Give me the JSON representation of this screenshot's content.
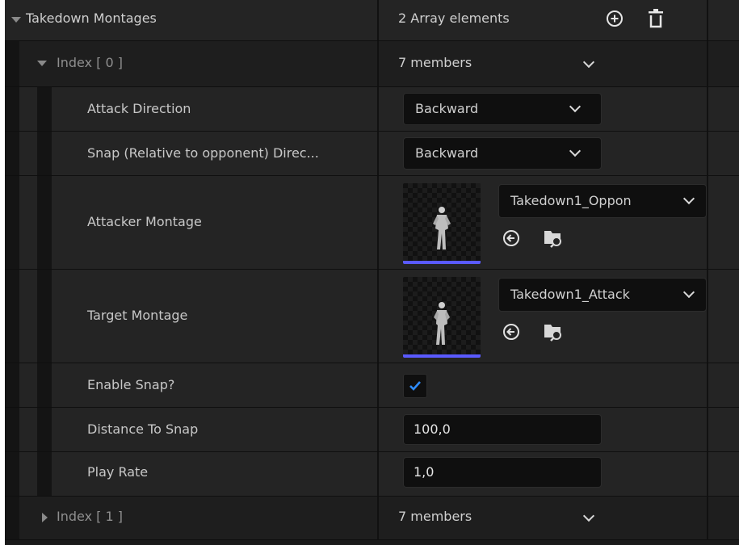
{
  "header": {
    "title": "Takedown Montages",
    "value": "2 Array elements",
    "add_icon": "plus-circle-icon",
    "delete_icon": "trash-icon"
  },
  "index0": {
    "label": "Index [ 0 ]",
    "value": "7 members",
    "expanded": true
  },
  "fields": {
    "attack_direction": {
      "label": "Attack Direction",
      "value": "Backward"
    },
    "snap_direction": {
      "label": "Snap (Relative to opponent) Direc...",
      "value": "Backward"
    },
    "attacker_montage": {
      "label": "Attacker Montage",
      "asset": "Takedown1_Oppon",
      "thumb_color": "#5a5aff"
    },
    "target_montage": {
      "label": "Target Montage",
      "asset": "Takedown1_Attack",
      "thumb_color": "#5a5aff"
    },
    "enable_snap": {
      "label": "Enable Snap?",
      "checked": true,
      "check_color": "#2e8cff"
    },
    "distance_to_snap": {
      "label": "Distance To Snap",
      "value": "100,0"
    },
    "play_rate": {
      "label": "Play Rate",
      "value": "1,0"
    }
  },
  "index1": {
    "label": "Index [ 1 ]",
    "value": "7 members",
    "expanded": false
  },
  "icons": {
    "use_selected": "arrow-left-circle-icon",
    "browse": "folder-search-icon"
  }
}
